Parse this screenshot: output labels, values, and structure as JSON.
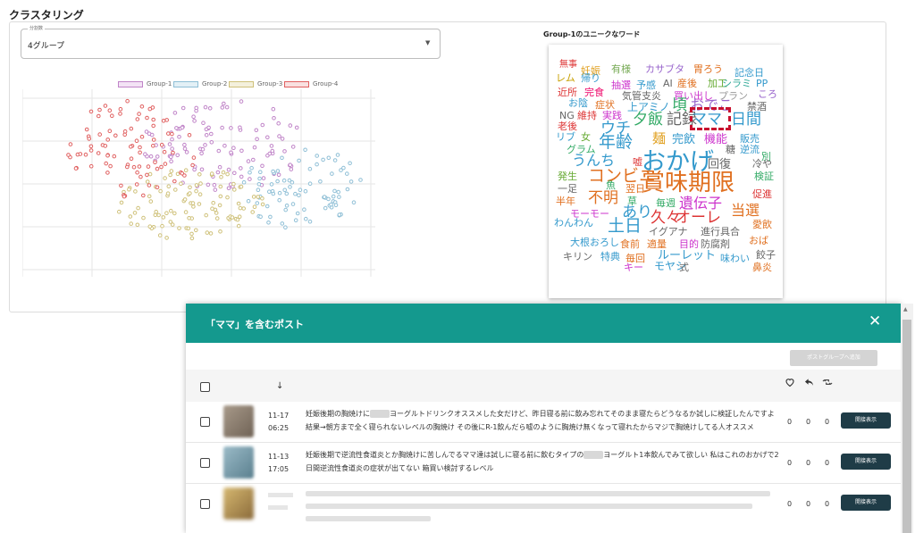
{
  "section_title": "クラスタリング",
  "select": {
    "label": "分割数",
    "value": "4グループ"
  },
  "legend": [
    {
      "name": "Group-1",
      "color": "#c084c8"
    },
    {
      "name": "Group-2",
      "color": "#8fbfd6"
    },
    {
      "name": "Group-3",
      "color": "#cfc17a"
    },
    {
      "name": "Group-4",
      "color": "#e06060"
    }
  ],
  "wordcloud": {
    "title": "Group-1のユニークなワード",
    "words": [
      {
        "t": "無事",
        "c": "#d33"
      },
      {
        "t": "妊娠",
        "c": "#e0a020"
      },
      {
        "t": "有様",
        "c": "#7a5"
      },
      {
        "t": "カサブタ",
        "c": "#96c"
      },
      {
        "t": "胃ろう",
        "c": "#e07020"
      },
      {
        "t": "レム",
        "c": "#c8a000"
      },
      {
        "t": "帰り",
        "c": "#39c"
      },
      {
        "t": "記念日",
        "c": "#39c"
      },
      {
        "t": "抽選",
        "c": "#c3c"
      },
      {
        "t": "予感",
        "c": "#39c"
      },
      {
        "t": "AI",
        "c": "#666"
      },
      {
        "t": "産後",
        "c": "#e07020"
      },
      {
        "t": "加工",
        "c": "#6a3"
      },
      {
        "t": "シラミ",
        "c": "#3a9"
      },
      {
        "t": "PP",
        "c": "#39c"
      },
      {
        "t": "近所",
        "c": "#d33"
      },
      {
        "t": "完食",
        "c": "#e06"
      },
      {
        "t": "気管支炎",
        "c": "#666"
      },
      {
        "t": "買い出し",
        "c": "#c3c"
      },
      {
        "t": "プラン",
        "c": "#999"
      },
      {
        "t": "ころ",
        "c": "#96c"
      },
      {
        "t": "お陰",
        "c": "#39c"
      },
      {
        "t": "症状",
        "c": "#e07020"
      },
      {
        "t": "上アミノ",
        "c": "#39c"
      },
      {
        "t": "頃",
        "c": "#3a6"
      },
      {
        "t": "おでこ",
        "c": "#96c"
      },
      {
        "t": "禁酒",
        "c": "#666"
      },
      {
        "t": "NG",
        "c": "#666"
      },
      {
        "t": "維持",
        "c": "#d33"
      },
      {
        "t": "実践",
        "c": "#c3c"
      },
      {
        "t": "夕飯",
        "c": "#3a6"
      },
      {
        "t": "記録",
        "c": "#666"
      },
      {
        "t": "ママ",
        "c": "#39c"
      },
      {
        "t": "日間",
        "c": "#39c"
      },
      {
        "t": "老後",
        "c": "#d33"
      },
      {
        "t": "ウチ",
        "c": "#39c"
      },
      {
        "t": "リブ",
        "c": "#39c"
      },
      {
        "t": "女",
        "c": "#6a3"
      },
      {
        "t": "年齢",
        "c": "#39c"
      },
      {
        "t": "麺",
        "c": "#e0a020"
      },
      {
        "t": "完飲",
        "c": "#39c"
      },
      {
        "t": "機能",
        "c": "#c3c"
      },
      {
        "t": "販売",
        "c": "#39c"
      },
      {
        "t": "糖",
        "c": "#666"
      },
      {
        "t": "グラム",
        "c": "#3a6"
      },
      {
        "t": "逆流",
        "c": "#39c"
      },
      {
        "t": "別",
        "c": "#3a6"
      },
      {
        "t": "うんち",
        "c": "#39c"
      },
      {
        "t": "嘘",
        "c": "#d33"
      },
      {
        "t": "おかげ",
        "c": "#39c"
      },
      {
        "t": "回復",
        "c": "#666"
      },
      {
        "t": "冷や",
        "c": "#666"
      },
      {
        "t": "発生",
        "c": "#6a3"
      },
      {
        "t": "コンビニ",
        "c": "#e07020"
      },
      {
        "t": "検証",
        "c": "#3a6"
      },
      {
        "t": "一足",
        "c": "#666"
      },
      {
        "t": "魚",
        "c": "#3a6"
      },
      {
        "t": "翌日",
        "c": "#e07020"
      },
      {
        "t": "賞味期限",
        "c": "#e07020"
      },
      {
        "t": "促進",
        "c": "#d33"
      },
      {
        "t": "半年",
        "c": "#e07020"
      },
      {
        "t": "不明",
        "c": "#e07020"
      },
      {
        "t": "草",
        "c": "#3a6"
      },
      {
        "t": "毎週",
        "c": "#3a6"
      },
      {
        "t": "遺伝子",
        "c": "#c3c"
      },
      {
        "t": "モーモー",
        "c": "#c3c"
      },
      {
        "t": "あり",
        "c": "#39c"
      },
      {
        "t": "久々",
        "c": "#d33"
      },
      {
        "t": "オーレ",
        "c": "#d33"
      },
      {
        "t": "当選",
        "c": "#e07020"
      },
      {
        "t": "愛飲",
        "c": "#e07020"
      },
      {
        "t": "わんわん",
        "c": "#39c"
      },
      {
        "t": "土日",
        "c": "#39c"
      },
      {
        "t": "イグアナ",
        "c": "#666"
      },
      {
        "t": "進行具合",
        "c": "#666"
      },
      {
        "t": "おば",
        "c": "#e07020"
      },
      {
        "t": "大根おろし",
        "c": "#39c"
      },
      {
        "t": "食前",
        "c": "#e07020"
      },
      {
        "t": "適量",
        "c": "#e07020"
      },
      {
        "t": "目的",
        "c": "#c3c"
      },
      {
        "t": "防腐剤",
        "c": "#666"
      },
      {
        "t": "キリン",
        "c": "#666"
      },
      {
        "t": "特典",
        "c": "#39c"
      },
      {
        "t": "毎回",
        "c": "#e07020"
      },
      {
        "t": "ルーレット",
        "c": "#39c"
      },
      {
        "t": "餃子",
        "c": "#666"
      },
      {
        "t": "キー",
        "c": "#c3c"
      },
      {
        "t": "モヤシ",
        "c": "#39c"
      },
      {
        "t": "式",
        "c": "#666"
      },
      {
        "t": "味わい",
        "c": "#39c"
      },
      {
        "t": "鼻炎",
        "c": "#e07020"
      }
    ]
  },
  "modal": {
    "title": "「ママ」を含むポスト",
    "add_group_label": "ポストグループへ追加",
    "sort_arrow": "↓",
    "posts": [
      {
        "date": "11-17",
        "time": "06:25",
        "text_a": "妊娠後期の胸焼けに",
        "text_b": "ヨーグルトドリンクオススメした女だけど、昨日寝る前に飲み忘れてそのまま寝たらどうなるか試しに検証したんですよ 結果→朝方まで全く寝られないレベルの胸焼け その後にR-1飲んだら嘘のように胸焼け無くなって寝れたからマジで胸焼けしてる人オススメ",
        "likes": "0",
        "replies": "0",
        "retweets": "0",
        "button": "開接表示",
        "thumb": "#8a7a6a"
      },
      {
        "date": "11-13",
        "time": "17:05",
        "text_a": "妊娠後期で逆流性食道炎とか胸焼けに苦しんでるママ達は試しに寝る前に飲むタイプの",
        "text_b": "ヨーグルト1本飲んでみて欲しい 私はこれのおかげで2日間逆流性食道炎の症状が出てない 箱買い検討するレベル",
        "likes": "0",
        "replies": "0",
        "retweets": "0",
        "button": "開接表示",
        "thumb": "#7a9aa6"
      },
      {
        "likes": "0",
        "replies": "0",
        "retweets": "0",
        "button": "開接表示",
        "thumb": "#b89a5a"
      }
    ]
  }
}
